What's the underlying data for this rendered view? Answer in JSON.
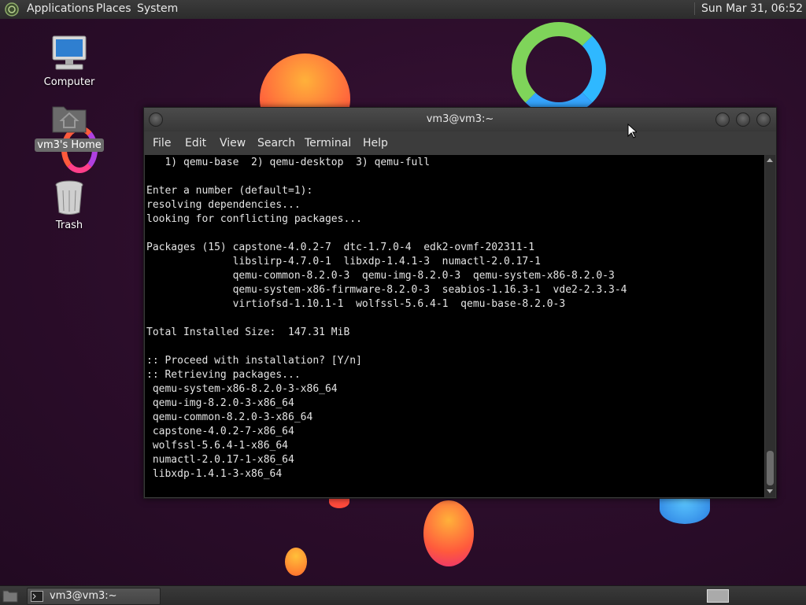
{
  "top_panel": {
    "menus": [
      "Applications",
      "Places",
      "System"
    ],
    "clock": "Sun Mar 31, 06:52"
  },
  "desktop": {
    "icons": [
      {
        "label": "Computer",
        "icon": "computer-icon"
      },
      {
        "label": "vm3's Home",
        "icon": "home-folder-icon",
        "selected": true
      },
      {
        "label": "Trash",
        "icon": "trash-icon"
      }
    ]
  },
  "window": {
    "title": "vm3@vm3:~",
    "menu": [
      "File",
      "Edit",
      "View",
      "Search",
      "Terminal",
      "Help"
    ],
    "terminal_lines": [
      "   1) qemu-base  2) qemu-desktop  3) qemu-full",
      "",
      "Enter a number (default=1):",
      "resolving dependencies...",
      "looking for conflicting packages...",
      "",
      "Packages (15) capstone-4.0.2-7  dtc-1.7.0-4  edk2-ovmf-202311-1",
      "              libslirp-4.7.0-1  libxdp-1.4.1-3  numactl-2.0.17-1",
      "              qemu-common-8.2.0-3  qemu-img-8.2.0-3  qemu-system-x86-8.2.0-3",
      "              qemu-system-x86-firmware-8.2.0-3  seabios-1.16.3-1  vde2-2.3.3-4",
      "              virtiofsd-1.10.1-1  wolfssl-5.6.4-1  qemu-base-8.2.0-3",
      "",
      "Total Installed Size:  147.31 MiB",
      "",
      ":: Proceed with installation? [Y/n]",
      ":: Retrieving packages...",
      " qemu-system-x86-8.2.0-3-x86_64",
      " qemu-img-8.2.0-3-x86_64",
      " qemu-common-8.2.0-3-x86_64",
      " capstone-4.0.2-7-x86_64",
      " wolfssl-5.6.4-1-x86_64",
      " numactl-2.0.17-1-x86_64",
      " libxdp-1.4.1-3-x86_64"
    ]
  },
  "taskbar": {
    "task_label": "vm3@vm3:~"
  }
}
